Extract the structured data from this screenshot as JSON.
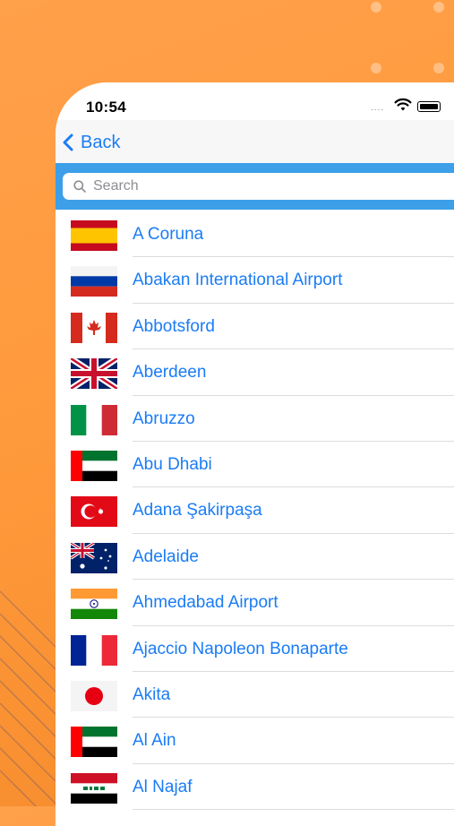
{
  "status_bar": {
    "time": "10:54",
    "signal": "....",
    "wifi_icon": "wifi-icon",
    "battery_icon": "battery-icon"
  },
  "nav": {
    "back_label": "Back",
    "back_icon": "chevron-left-icon"
  },
  "search": {
    "placeholder": "Search",
    "icon": "search-icon"
  },
  "colors": {
    "background": "#ff9a3c",
    "accent": "#1a7cf5",
    "search_band": "#3c9fe8"
  },
  "cities": [
    {
      "name": "A Coruna",
      "flag": "spain-flag"
    },
    {
      "name": "Abakan International Airport",
      "flag": "russia-flag"
    },
    {
      "name": "Abbotsford",
      "flag": "canada-flag"
    },
    {
      "name": "Aberdeen",
      "flag": "uk-flag"
    },
    {
      "name": "Abruzzo",
      "flag": "italy-flag"
    },
    {
      "name": "Abu Dhabi",
      "flag": "uae-flag"
    },
    {
      "name": "Adana Şakirpaşa",
      "flag": "turkey-flag"
    },
    {
      "name": "Adelaide",
      "flag": "australia-flag"
    },
    {
      "name": "Ahmedabad Airport",
      "flag": "india-flag"
    },
    {
      "name": "Ajaccio Napoleon Bonaparte",
      "flag": "france-flag"
    },
    {
      "name": "Akita",
      "flag": "japan-flag"
    },
    {
      "name": "Al Ain",
      "flag": "uae-flag"
    },
    {
      "name": "Al Najaf",
      "flag": "iraq-flag"
    }
  ]
}
